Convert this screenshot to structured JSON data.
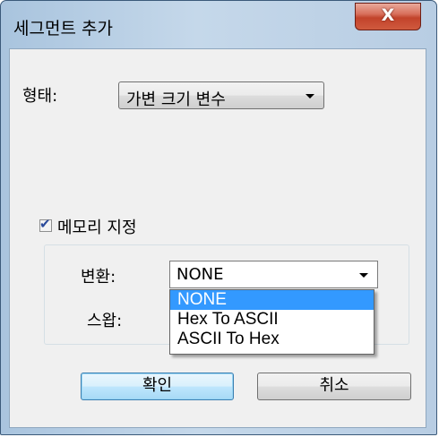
{
  "window": {
    "title": "세그먼트 추가",
    "close_label": "X"
  },
  "form": {
    "type_label": "형태:",
    "type_value": "가변 크기 변수",
    "memory_checkbox_label": "메모리 지정",
    "memory_checked": true,
    "convert_label": "변환:",
    "convert_value": "NONE",
    "swap_label": "스왑:",
    "convert_options": [
      {
        "label": "NONE",
        "selected": true
      },
      {
        "label": "Hex To ASCII",
        "selected": false
      },
      {
        "label": "ASCII To Hex",
        "selected": false
      }
    ]
  },
  "buttons": {
    "ok_label": "확인",
    "cancel_label": "취소"
  },
  "colors": {
    "selection": "#3399ff",
    "close_button": "#c2432b"
  }
}
